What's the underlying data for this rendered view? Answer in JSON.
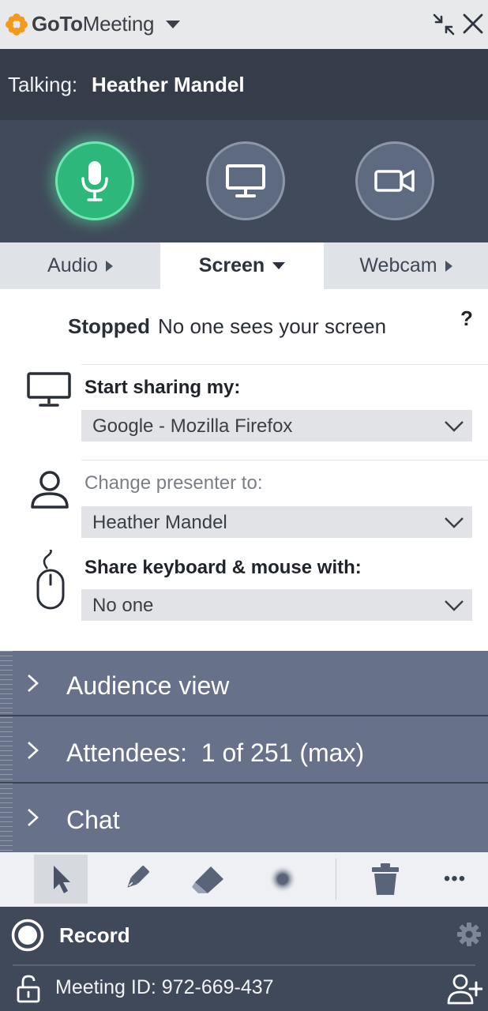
{
  "app": {
    "brand_bold": "GoTo",
    "brand_light": "Meeting"
  },
  "talking": {
    "label": "Talking:",
    "name": "Heather Mandel"
  },
  "colors": {
    "mic_active": "#2db77a",
    "control_bg": "#414a5a",
    "accordion_bg": "#67728a",
    "brand_orange": "#f39a1e"
  },
  "tabs": [
    {
      "label": "Audio",
      "active": false
    },
    {
      "label": "Screen",
      "active": true
    },
    {
      "label": "Webcam",
      "active": false
    }
  ],
  "screen": {
    "status_strong": "Stopped",
    "status_text": "No one sees your screen",
    "help": "?",
    "share_label": "Start sharing my:",
    "share_value": "Google - Mozilla Firefox",
    "presenter_label": "Change presenter to:",
    "presenter_value": "Heather Mandel",
    "keyboard_label": "Share keyboard & mouse with:",
    "keyboard_value": "No one"
  },
  "accordion": [
    {
      "label": "Audience view"
    },
    {
      "label": "Attendees:  1 of 251 (max)"
    },
    {
      "label": "Chat"
    }
  ],
  "toolbar": {
    "tools": [
      "pointer-icon",
      "pen-icon",
      "highlighter-icon",
      "spotlight-icon",
      "trash-icon",
      "more-icon"
    ],
    "more": "•••"
  },
  "bottom": {
    "record_label": "Record",
    "meeting_id": "Meeting ID: 972-669-437"
  }
}
